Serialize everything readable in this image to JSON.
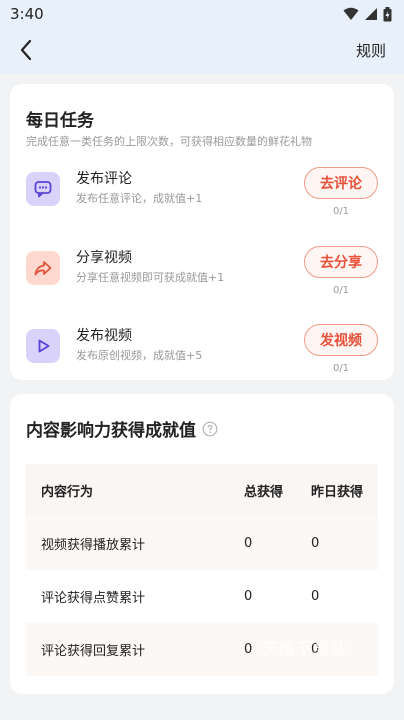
{
  "status_bar": {
    "time": "3:40"
  },
  "nav": {
    "back_icon": "chevron-left-icon",
    "rules_label": "规则"
  },
  "daily": {
    "title": "每日任务",
    "subtitle": "完成任意一类任务的上限次数，可获得相应数量的鲜花礼物",
    "tasks": [
      {
        "name": "发布评论",
        "desc": "发布任意评论，成就值+1",
        "button": "去评论",
        "progress": "0/1",
        "icon": "comment-icon",
        "icon_bg": "#d9d3fb",
        "icon_color": "#5b43d6"
      },
      {
        "name": "分享视频",
        "desc": "分享任意视频即可获成就值+1",
        "button": "去分享",
        "progress": "0/1",
        "icon": "share-icon",
        "icon_bg": "#ffd9cf",
        "icon_color": "#e3553c"
      },
      {
        "name": "发布视频",
        "desc": "发布原创视频，成就值+5",
        "button": "发视频",
        "progress": "0/1",
        "icon": "play-icon",
        "icon_bg": "#d9d3fb",
        "icon_color": "#5b43d6"
      }
    ]
  },
  "influence": {
    "title": "内容影响力获得成就值",
    "table": {
      "headers": [
        "内容行为",
        "总获得",
        "昨日获得"
      ],
      "rows": [
        [
          "视频获得播放累计",
          "0",
          "0"
        ],
        [
          "评论获得点赞累计",
          "0",
          "0"
        ],
        [
          "评论获得回复累计",
          "0",
          "0"
        ]
      ]
    }
  },
  "watermark": "天暗下载站",
  "colors": {
    "accent": "#e8513a",
    "topbar_bg": "#e8f1fb",
    "page_bg": "#f2f3f5"
  }
}
